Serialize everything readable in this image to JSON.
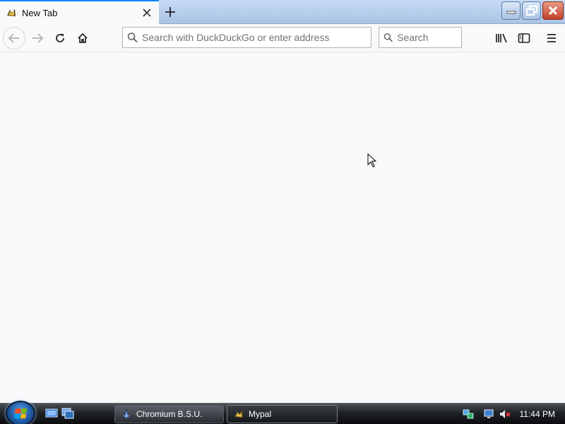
{
  "browser": {
    "tab": {
      "title": "New Tab",
      "favicon": "mypal-icon"
    },
    "new_tab_icon": "plus-icon",
    "window_buttons": [
      "minimize-icon",
      "restore-icon",
      "close-icon"
    ],
    "nav": {
      "back_icon": "back-arrow-icon",
      "forward_icon": "forward-arrow-icon",
      "reload_icon": "reload-icon",
      "home_icon": "home-icon"
    },
    "urlbar": {
      "placeholder": "Search with DuckDuckGo or enter address",
      "value": ""
    },
    "searchbar": {
      "placeholder": "Search",
      "value": ""
    },
    "toolbar_icons": [
      "library-icon",
      "sidebar-icon",
      "menu-icon"
    ]
  },
  "taskbar": {
    "items": [
      {
        "label": "Chromium B.S.U.",
        "active": false
      },
      {
        "label": "Mypal",
        "active": true
      }
    ],
    "clock": "11:44 PM"
  },
  "colors": {
    "accent": "#0a84ff",
    "content_bg": "#f9f9fb",
    "close_button": "#c3412a"
  }
}
